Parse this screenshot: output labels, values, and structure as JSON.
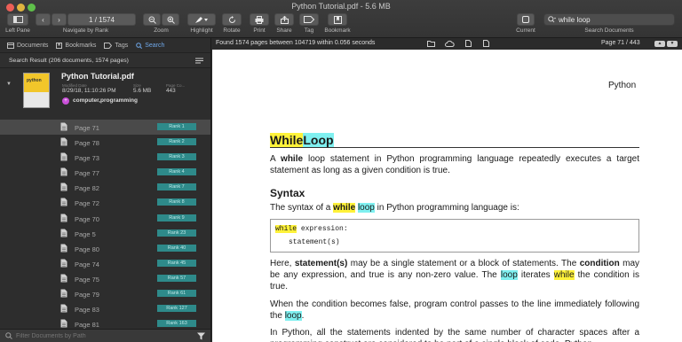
{
  "window": {
    "title": "Python Tutorial.pdf - 5.6 MB"
  },
  "toolbar": {
    "page_field": "1 / 1574",
    "labels": {
      "left_pane": "Left Pane",
      "navigate": "Navigate by Rank",
      "zoom": "Zoom",
      "highlight": "Highlight",
      "rotate": "Rotate",
      "print": "Print",
      "share": "Share",
      "tag": "Tag",
      "bookmark": "Bookmark",
      "current": "Current",
      "search_documents": "Search Documents"
    },
    "search_value": "while loop"
  },
  "sidebar": {
    "tabs": [
      "Documents",
      "Bookmarks",
      "Tags",
      "Search"
    ],
    "result_header": "Search Result (206 documents, 1574 pages)",
    "document": {
      "title": "Python Tutorial.pdf",
      "cover_text": "python",
      "meta": [
        {
          "label": "Modified Date",
          "value": "8/29/18, 11:10:26 PM"
        },
        {
          "label": "Size",
          "value": "5.6 MB"
        },
        {
          "label": "Page Co...",
          "value": "443"
        }
      ],
      "tag": "computer,programming"
    },
    "results": [
      {
        "page": "Page 71",
        "rank": "Rank 1"
      },
      {
        "page": "Page 78",
        "rank": "Rank 2"
      },
      {
        "page": "Page 73",
        "rank": "Rank 3"
      },
      {
        "page": "Page 77",
        "rank": "Rank 4"
      },
      {
        "page": "Page 82",
        "rank": "Rank 7"
      },
      {
        "page": "Page 72",
        "rank": "Rank 8"
      },
      {
        "page": "Page 70",
        "rank": "Rank 9"
      },
      {
        "page": "Page 5",
        "rank": "Rank 23"
      },
      {
        "page": "Page 80",
        "rank": "Rank 40"
      },
      {
        "page": "Page 74",
        "rank": "Rank 45"
      },
      {
        "page": "Page 75",
        "rank": "Rank 57"
      },
      {
        "page": "Page 79",
        "rank": "Rank 61"
      },
      {
        "page": "Page 83",
        "rank": "Rank 127"
      },
      {
        "page": "Page 81",
        "rank": "Rank 163"
      }
    ],
    "selected_index": 0,
    "filter_placeholder": "Filter Documents by Path"
  },
  "status": {
    "found": "Found 1574 pages between 104719 within 0.056 seconds",
    "page_info": "Page 71 / 443"
  },
  "pdf": {
    "running_header": "Python",
    "heading_while": "While",
    "heading_loop": "Loop",
    "p1_pre": "A ",
    "p1_bold": "while",
    "p1_post": " loop statement in Python programming language repeatedly executes a target statement as long as a given condition is true.",
    "syntax_heading": "Syntax",
    "syntax_pre": "The syntax of a ",
    "syntax_while": "while",
    "syntax_loop": "loop",
    "syntax_post": " in Python programming language is:",
    "code_while": "while",
    "code_line1_rest": " expression:",
    "code_line2": "statement(s)",
    "p3_a": "Here, ",
    "p3_b": "statement(s)",
    "p3_c": " may be a single statement or a block of statements. The ",
    "p3_d": "condition",
    "p3_e": " may be any expression, and true is any non-zero value. The ",
    "p3_loop": "loop",
    "p3_f": " iterates ",
    "p3_while": "while",
    "p3_g": " the condition is true.",
    "p4_a": "When the condition becomes false, program control passes to the line immediately following the ",
    "p4_loop": "loop",
    "p4_b": ".",
    "p5": "In Python, all the statements indented by the same number of character spaces after a programming construct are considered to be part of a single block of code. Python"
  },
  "colors": {
    "highlight_yellow": "#fff23a",
    "highlight_cyan": "#7ff0f0",
    "rank_badge": "#2e8a8a",
    "accent_tab": "#6fa7e8"
  }
}
